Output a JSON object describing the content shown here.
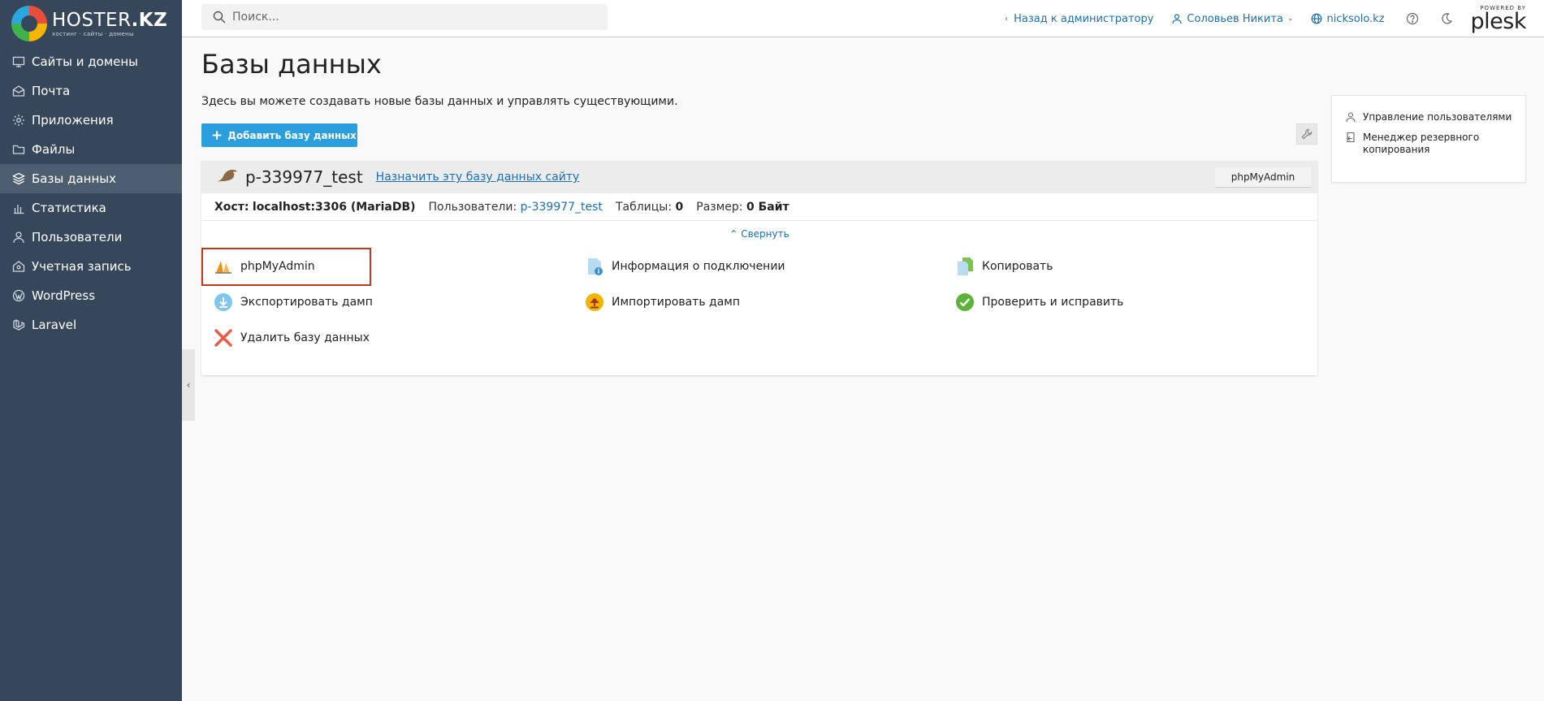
{
  "brand": {
    "name_main": "HOSTER",
    "name_suffix": ".KZ",
    "tagline": "хостинг · сайты · домены"
  },
  "sidebar": {
    "items": [
      {
        "label": "Сайты и домены",
        "icon": "monitor-icon"
      },
      {
        "label": "Почта",
        "icon": "mail-icon"
      },
      {
        "label": "Приложения",
        "icon": "gear-icon"
      },
      {
        "label": "Файлы",
        "icon": "folder-icon"
      },
      {
        "label": "Базы данных",
        "icon": "layers-icon",
        "active": true
      },
      {
        "label": "Статистика",
        "icon": "bar-chart-icon"
      },
      {
        "label": "Пользователи",
        "icon": "user-icon"
      },
      {
        "label": "Учетная запись",
        "icon": "account-icon"
      },
      {
        "label": "WordPress",
        "icon": "wordpress-icon"
      },
      {
        "label": "Laravel",
        "icon": "laravel-icon"
      }
    ]
  },
  "header": {
    "search_placeholder": "Поиск...",
    "back_link": "Назад к администратору",
    "user": "Соловьев Никита",
    "domain": "nicksolo.kz",
    "powered_by": "POWERED BY",
    "plesk": "plesk"
  },
  "main": {
    "title": "Базы данных",
    "description": "Здесь вы можете создавать новые базы данных и управлять существующими.",
    "add_button": "Добавить базу данных"
  },
  "database": {
    "name": "p-339977_test",
    "assign_link": "Назначить эту базу данных сайту",
    "phpmyadmin_button": "phpMyAdmin",
    "host_label": "Хост:",
    "host_value": "localhost:3306 (MariaDB)",
    "users_label": "Пользователи:",
    "users_value": "p-339977_test",
    "tables_label": "Таблицы:",
    "tables_value": "0",
    "size_label": "Размер:",
    "size_value": "0 Байт",
    "collapse": "Свернуть",
    "actions": {
      "phpmyadmin": "phpMyAdmin",
      "connection_info": "Информация о подключении",
      "copy": "Копировать",
      "export_dump": "Экспортировать дамп",
      "import_dump": "Импортировать дамп",
      "check_repair": "Проверить и исправить",
      "delete": "Удалить базу данных"
    }
  },
  "side_panel": {
    "user_management": "Управление пользователями",
    "backup_manager": "Менеджер резервного копирования"
  },
  "colors": {
    "sidebar_bg": "#37475b",
    "accent": "#2b9ede",
    "link": "#1c6fb0",
    "highlight": "#c0391a"
  }
}
